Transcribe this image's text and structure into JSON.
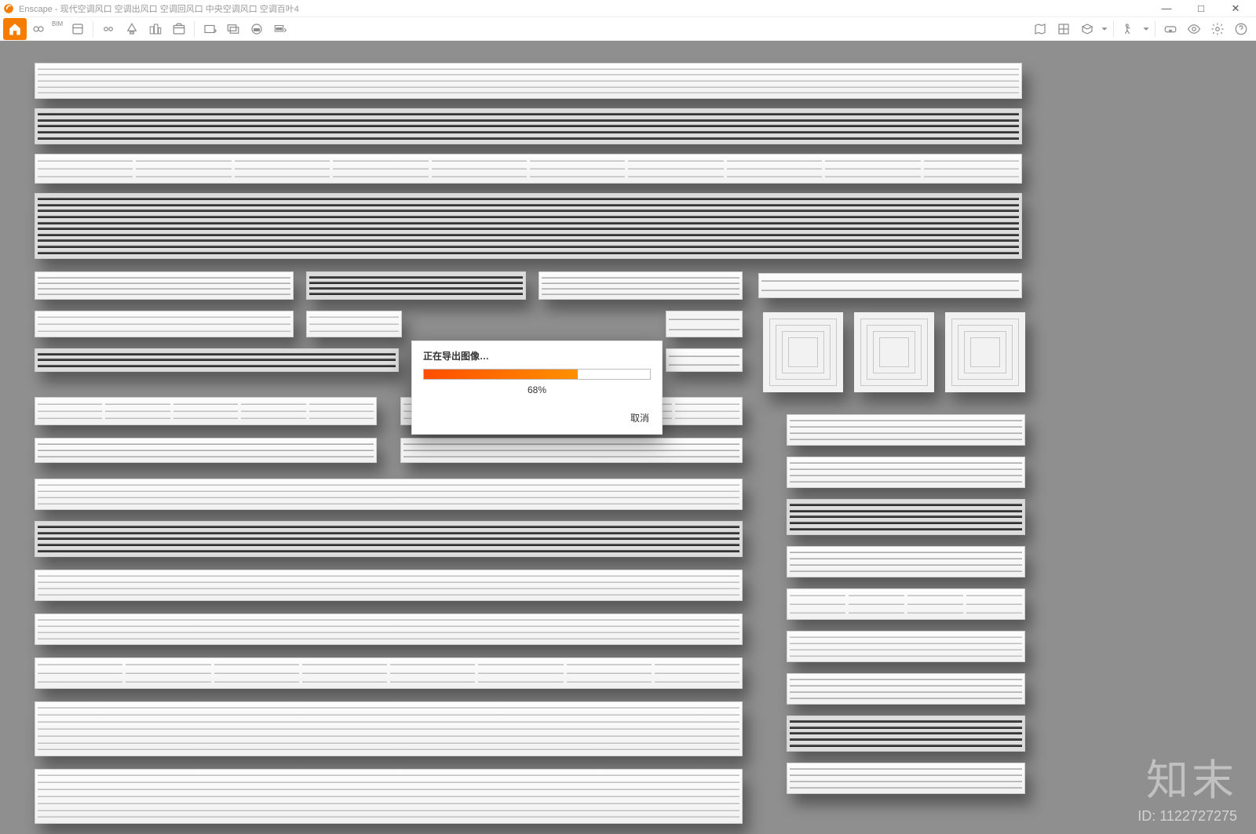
{
  "app": {
    "name": "Enscape",
    "window_title": "Enscape - 现代空调风口 空调出风口 空调回风口 中央空调风口 空调百叶4"
  },
  "window_controls": {
    "minimize": "—",
    "maximize": "□",
    "close": "✕"
  },
  "toolbar": {
    "bim_label": "BIM",
    "icons_left": [
      "home-icon",
      "link-icon",
      "bim-icon",
      "binoculars-icon",
      "lightbulb-icon",
      "buildings-icon",
      "clapper-icon",
      "export-image-icon",
      "export-batch-icon",
      "panorama-360-icon",
      "export-exe-icon"
    ],
    "icons_right": [
      "map-icon",
      "asset-library-icon",
      "cube-icon",
      "chevron-down-icon",
      "walk-icon",
      "chevron-down-icon",
      "vr-icon",
      "eye-icon",
      "gear-icon",
      "help-icon"
    ]
  },
  "dialog": {
    "title": "正在导出图像…",
    "percent_text": "68%",
    "percent_value": 68,
    "cancel": "取消"
  },
  "watermark": {
    "brand": "知末",
    "id_label": "ID: 1122727275"
  }
}
